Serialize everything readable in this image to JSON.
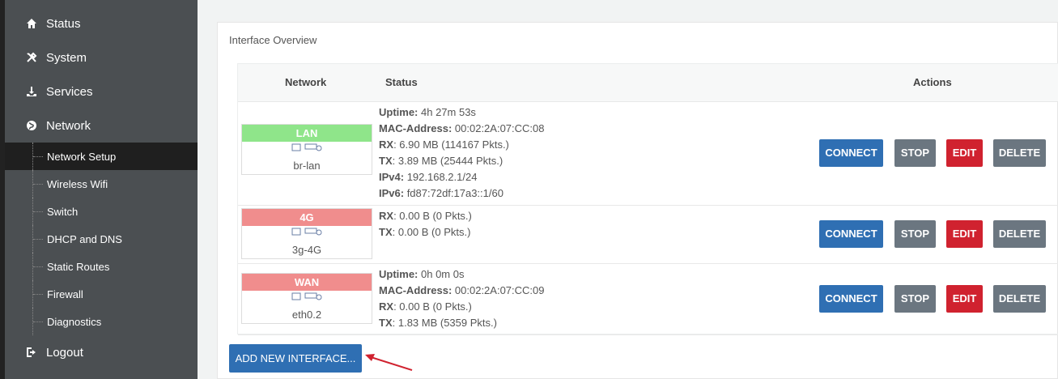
{
  "sidebar": {
    "main": [
      {
        "label": "Status",
        "icon": "home-icon"
      },
      {
        "label": "System",
        "icon": "tools-icon"
      },
      {
        "label": "Services",
        "icon": "download-icon"
      },
      {
        "label": "Network",
        "icon": "globe-icon"
      }
    ],
    "subs": [
      {
        "label": "Network Setup",
        "active": true
      },
      {
        "label": "Wireless Wifi"
      },
      {
        "label": "Switch"
      },
      {
        "label": "DHCP and DNS"
      },
      {
        "label": "Static Routes"
      },
      {
        "label": "Firewall"
      },
      {
        "label": "Diagnostics"
      }
    ],
    "logout": {
      "label": "Logout",
      "icon": "logout-icon"
    }
  },
  "panel": {
    "title": "Interface Overview",
    "headers": {
      "network": "Network",
      "status": "Status",
      "actions": "Actions"
    },
    "rows": [
      {
        "name": "LAN",
        "color": "#8fe58a",
        "device": "br-lan",
        "lines": [
          {
            "k": "Uptime:",
            "v": " 4h 27m 53s"
          },
          {
            "k": "MAC-Address:",
            "v": " 00:02:2A:07:CC:08"
          },
          {
            "k": "RX",
            "v": ": 6.90 MB (114167 Pkts.)"
          },
          {
            "k": "TX",
            "v": ": 3.89 MB (25444 Pkts.)"
          },
          {
            "k": "IPv4:",
            "v": " 192.168.2.1/24"
          },
          {
            "k": "IPv6:",
            "v": " fd87:72df:17a3::1/60"
          }
        ]
      },
      {
        "name": "4G",
        "color": "#f08d8d",
        "device": "3g-4G",
        "lines": [
          {
            "k": "RX",
            "v": ": 0.00 B (0 Pkts.)"
          },
          {
            "k": "TX",
            "v": ": 0.00 B (0 Pkts.)"
          }
        ]
      },
      {
        "name": "WAN",
        "color": "#f08d8d",
        "device": "eth0.2",
        "lines": [
          {
            "k": "Uptime:",
            "v": " 0h 0m 0s"
          },
          {
            "k": "MAC-Address:",
            "v": " 00:02:2A:07:CC:09"
          },
          {
            "k": "RX",
            "v": ": 0.00 B (0 Pkts.)"
          },
          {
            "k": "TX",
            "v": ": 1.83 MB (5359 Pkts.)"
          }
        ]
      }
    ],
    "buttons": {
      "connect": "CONNECT",
      "stop": "STOP",
      "edit": "EDIT",
      "delete": "DELETE"
    },
    "add_button": "ADD NEW INTERFACE..."
  }
}
